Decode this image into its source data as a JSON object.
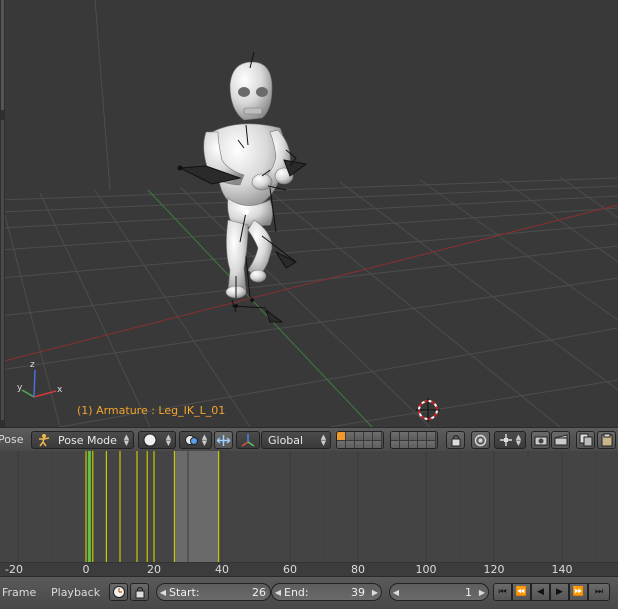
{
  "viewport": {
    "object_info": "(1) Armature : Leg_IK_L_01",
    "axis_labels": {
      "x": "x",
      "y": "y",
      "z": "z"
    }
  },
  "view3d_header": {
    "mode_menu_cut": "Pose",
    "interaction_mode": "Pose Mode",
    "viewport_shading_icon": "solid-sphere-icon",
    "pivot_icon": "pivot-icon",
    "transform_orientation": "Global",
    "colors": {
      "accent": "#f19a2b",
      "selected_text": "#f4a52b"
    }
  },
  "timeline": {
    "keyframe_color": "#c8c800",
    "current_frame_color": "#60c040",
    "keyframes": [
      0,
      1,
      2,
      6,
      10,
      15,
      18,
      20,
      26,
      39
    ],
    "current_frame": 1,
    "preview_range": [
      26,
      39
    ],
    "ruler_ticks": [
      "-20",
      "0",
      "20",
      "40",
      "60",
      "80",
      "100",
      "120",
      "140"
    ]
  },
  "timeline_header": {
    "menu_frame": "Frame",
    "menu_playback": "Playback",
    "start_label": "Start:",
    "start_value": "26",
    "end_label": "End:",
    "end_value": "39",
    "current_frame_value": "1"
  }
}
